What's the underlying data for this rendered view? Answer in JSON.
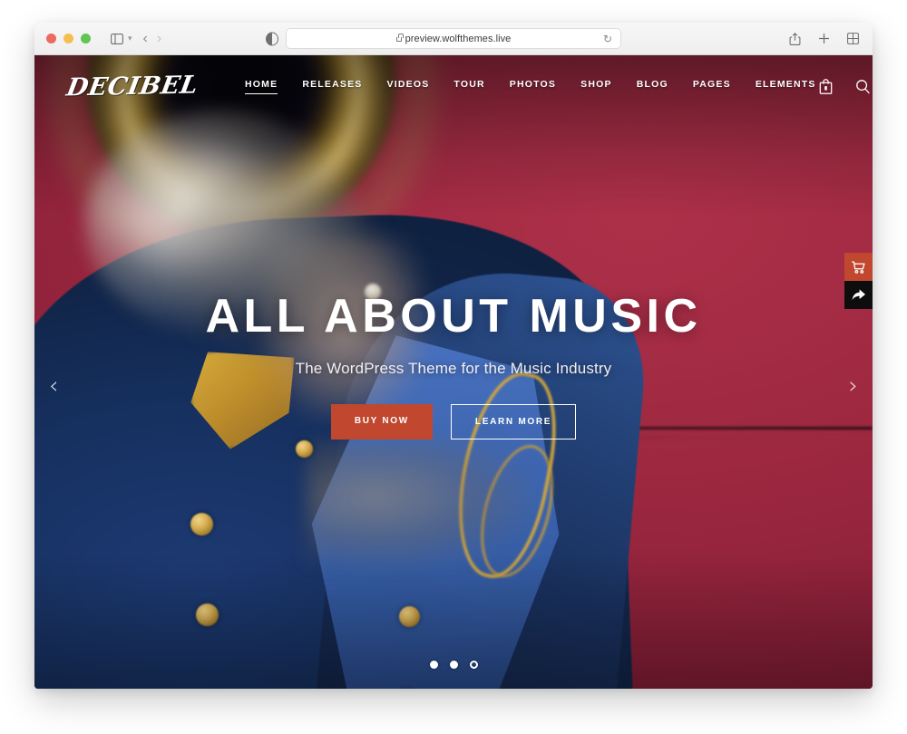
{
  "browser": {
    "url": "preview.wolfthemes.live",
    "lock_icon": "lock-icon",
    "reload_icon": "reload-icon",
    "traffic_lights": [
      "close-red",
      "minimize-yellow",
      "maximize-green"
    ],
    "sidebar_icon": "sidebar-toggle-icon",
    "chevron_icon": "chevron-down-icon",
    "back_icon": "back-arrow-icon",
    "forward_icon": "forward-arrow-icon",
    "reader_icon": "reader-mode-icon",
    "share_icon": "share-icon",
    "new_tab_icon": "plus-icon",
    "tab_overview_icon": "tab-overview-icon"
  },
  "site": {
    "logo": "DECIBEL",
    "menu": [
      {
        "label": "HOME",
        "active": true
      },
      {
        "label": "RELEASES",
        "active": false
      },
      {
        "label": "VIDEOS",
        "active": false
      },
      {
        "label": "TOUR",
        "active": false
      },
      {
        "label": "PHOTOS",
        "active": false
      },
      {
        "label": "SHOP",
        "active": false
      },
      {
        "label": "BLOG",
        "active": false
      },
      {
        "label": "PAGES",
        "active": false
      },
      {
        "label": "ELEMENTS",
        "active": false
      }
    ],
    "nav_icons": [
      "shopping-bag-icon",
      "search-icon",
      "instagram-icon",
      "spotify-icon",
      "hamburger-menu-icon"
    ],
    "hero": {
      "title": "ALL ABOUT MUSIC",
      "subtitle": "The WordPress Theme for the Music Industry",
      "primary_button": "BUY NOW",
      "secondary_button": "LEARN MORE",
      "prev_arrow": "‹",
      "next_arrow": "›",
      "slides_total": 3,
      "active_slide": 3
    },
    "side_tabs": [
      {
        "name": "cart-tab",
        "icon": "cart-icon",
        "color": "#c1482f"
      },
      {
        "name": "share-tab",
        "icon": "share-arrow-icon",
        "color": "#0d0d0d"
      }
    ],
    "colors": {
      "background": "#9c2740",
      "accent": "#c1482f",
      "uniform_blue": "#16305f",
      "text": "#ffffff"
    }
  }
}
